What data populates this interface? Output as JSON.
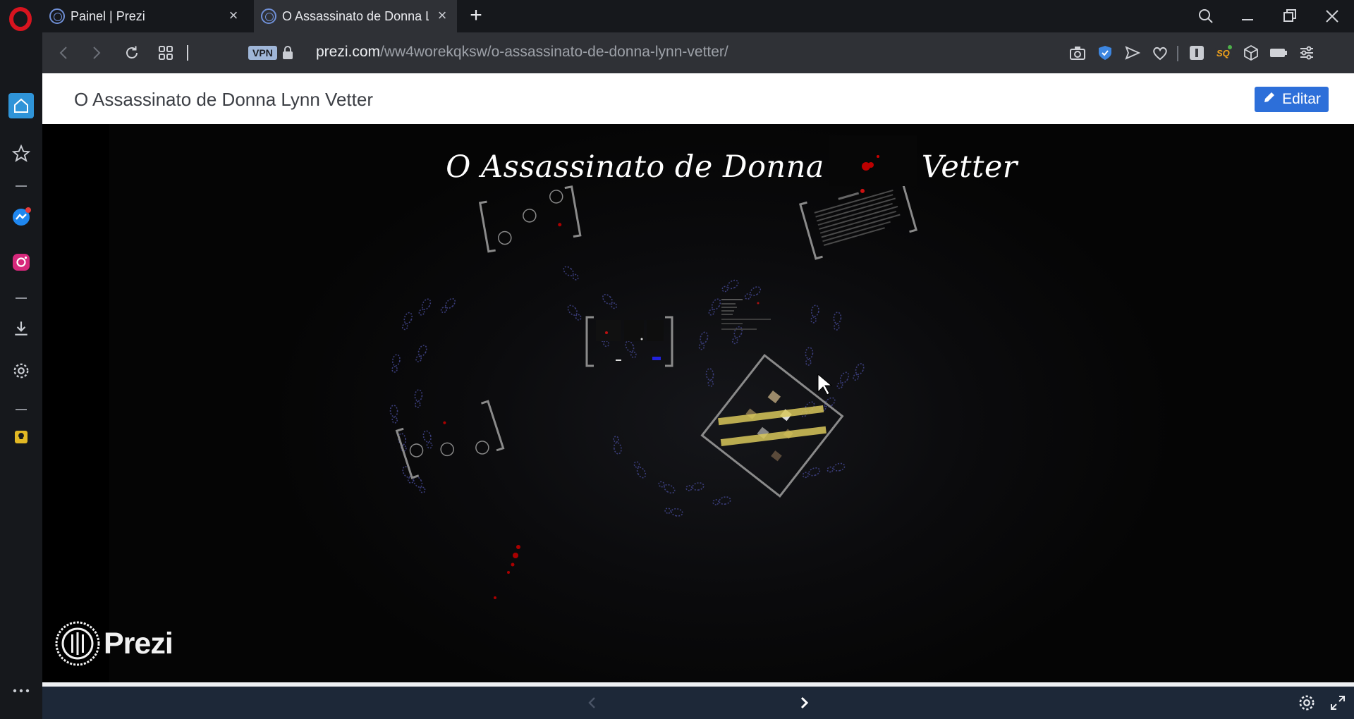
{
  "browser": {
    "tabs": [
      {
        "title": "Painel | Prezi",
        "active": false
      },
      {
        "title": "O Assassinato de Donna Lynn Vetter",
        "active": true
      }
    ],
    "address": {
      "vpn_label": "VPN",
      "url_host": "prezi.com",
      "url_path": "/ww4worekqksw/o-assassinato-de-donna-lynn-vetter/"
    },
    "colors": {
      "accent": "#2d6fd9",
      "messenger_badge": "#e53b3b"
    }
  },
  "sidebar": {
    "items": [
      "home-icon",
      "bookmarks-icon",
      "messenger-icon",
      "instagram-icon",
      "downloads-icon",
      "settings-icon",
      "tips-icon",
      "more-icon"
    ]
  },
  "page": {
    "title": "O Assassinato de Donna Lynn Vetter",
    "edit_label": "Editar"
  },
  "presentation": {
    "title": "O Assassinato de Donna Lynn Vetter",
    "logo_text": "Prezi"
  }
}
